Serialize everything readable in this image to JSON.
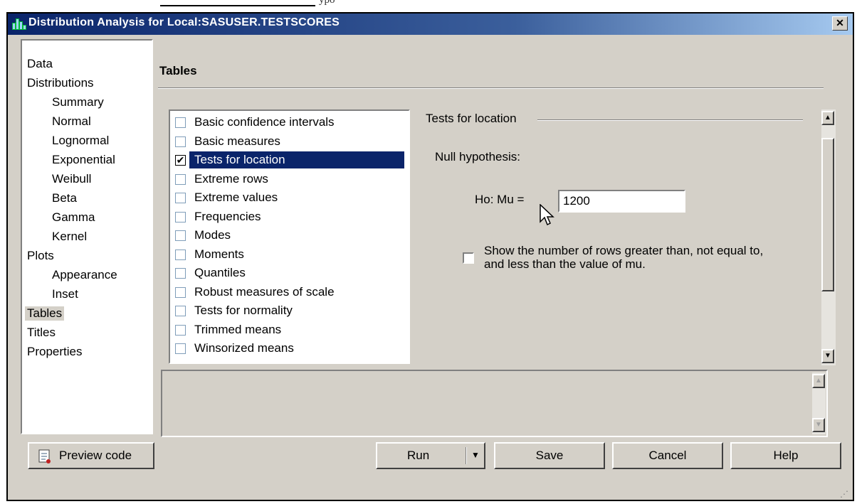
{
  "document": {
    "fragment_text": "ypo"
  },
  "window": {
    "title": "Distribution Analysis for Local:SASUSER.TESTSCORES",
    "close_glyph": "✕"
  },
  "nav": {
    "items": [
      {
        "label": "Data",
        "level": 0
      },
      {
        "label": "Distributions",
        "level": 0
      },
      {
        "label": "Summary",
        "level": 1
      },
      {
        "label": "Normal",
        "level": 1
      },
      {
        "label": "Lognormal",
        "level": 1
      },
      {
        "label": "Exponential",
        "level": 1
      },
      {
        "label": "Weibull",
        "level": 1
      },
      {
        "label": "Beta",
        "level": 1
      },
      {
        "label": "Gamma",
        "level": 1
      },
      {
        "label": "Kernel",
        "level": 1
      },
      {
        "label": "Plots",
        "level": 0
      },
      {
        "label": "Appearance",
        "level": 1
      },
      {
        "label": "Inset",
        "level": 1
      },
      {
        "label": "Tables",
        "level": 0,
        "selected": true
      },
      {
        "label": "Titles",
        "level": 0
      },
      {
        "label": "Properties",
        "level": 0
      }
    ]
  },
  "section": {
    "title": "Tables"
  },
  "tables_list": [
    {
      "label": "Basic confidence intervals",
      "checked": false
    },
    {
      "label": "Basic measures",
      "checked": false
    },
    {
      "label": "Tests for location",
      "checked": true,
      "selected": true
    },
    {
      "label": "Extreme rows",
      "checked": false
    },
    {
      "label": "Extreme values",
      "checked": false
    },
    {
      "label": "Frequencies",
      "checked": false
    },
    {
      "label": "Modes",
      "checked": false
    },
    {
      "label": "Moments",
      "checked": false
    },
    {
      "label": "Quantiles",
      "checked": false
    },
    {
      "label": "Robust measures of scale",
      "checked": false
    },
    {
      "label": "Tests for normality",
      "checked": false
    },
    {
      "label": "Trimmed means",
      "checked": false
    },
    {
      "label": "Winsorized means",
      "checked": false
    }
  ],
  "options": {
    "group_label": "Tests for location",
    "null_label": "Null hypothesis:",
    "ho_label": "Ho: Mu =",
    "mu_value": "1200",
    "show_rows_checked": false,
    "show_rows_label": "Show the number of rows greater than, not equal to, and less than the value of mu."
  },
  "buttons": {
    "preview": "Preview code",
    "run": "Run",
    "save": "Save",
    "cancel": "Cancel",
    "help": "Help"
  },
  "icons": {
    "checkmark": "✔",
    "scroll_up": "▲",
    "scroll_down": "▼",
    "dropdown": "▼",
    "resize_grip": "⋰"
  }
}
